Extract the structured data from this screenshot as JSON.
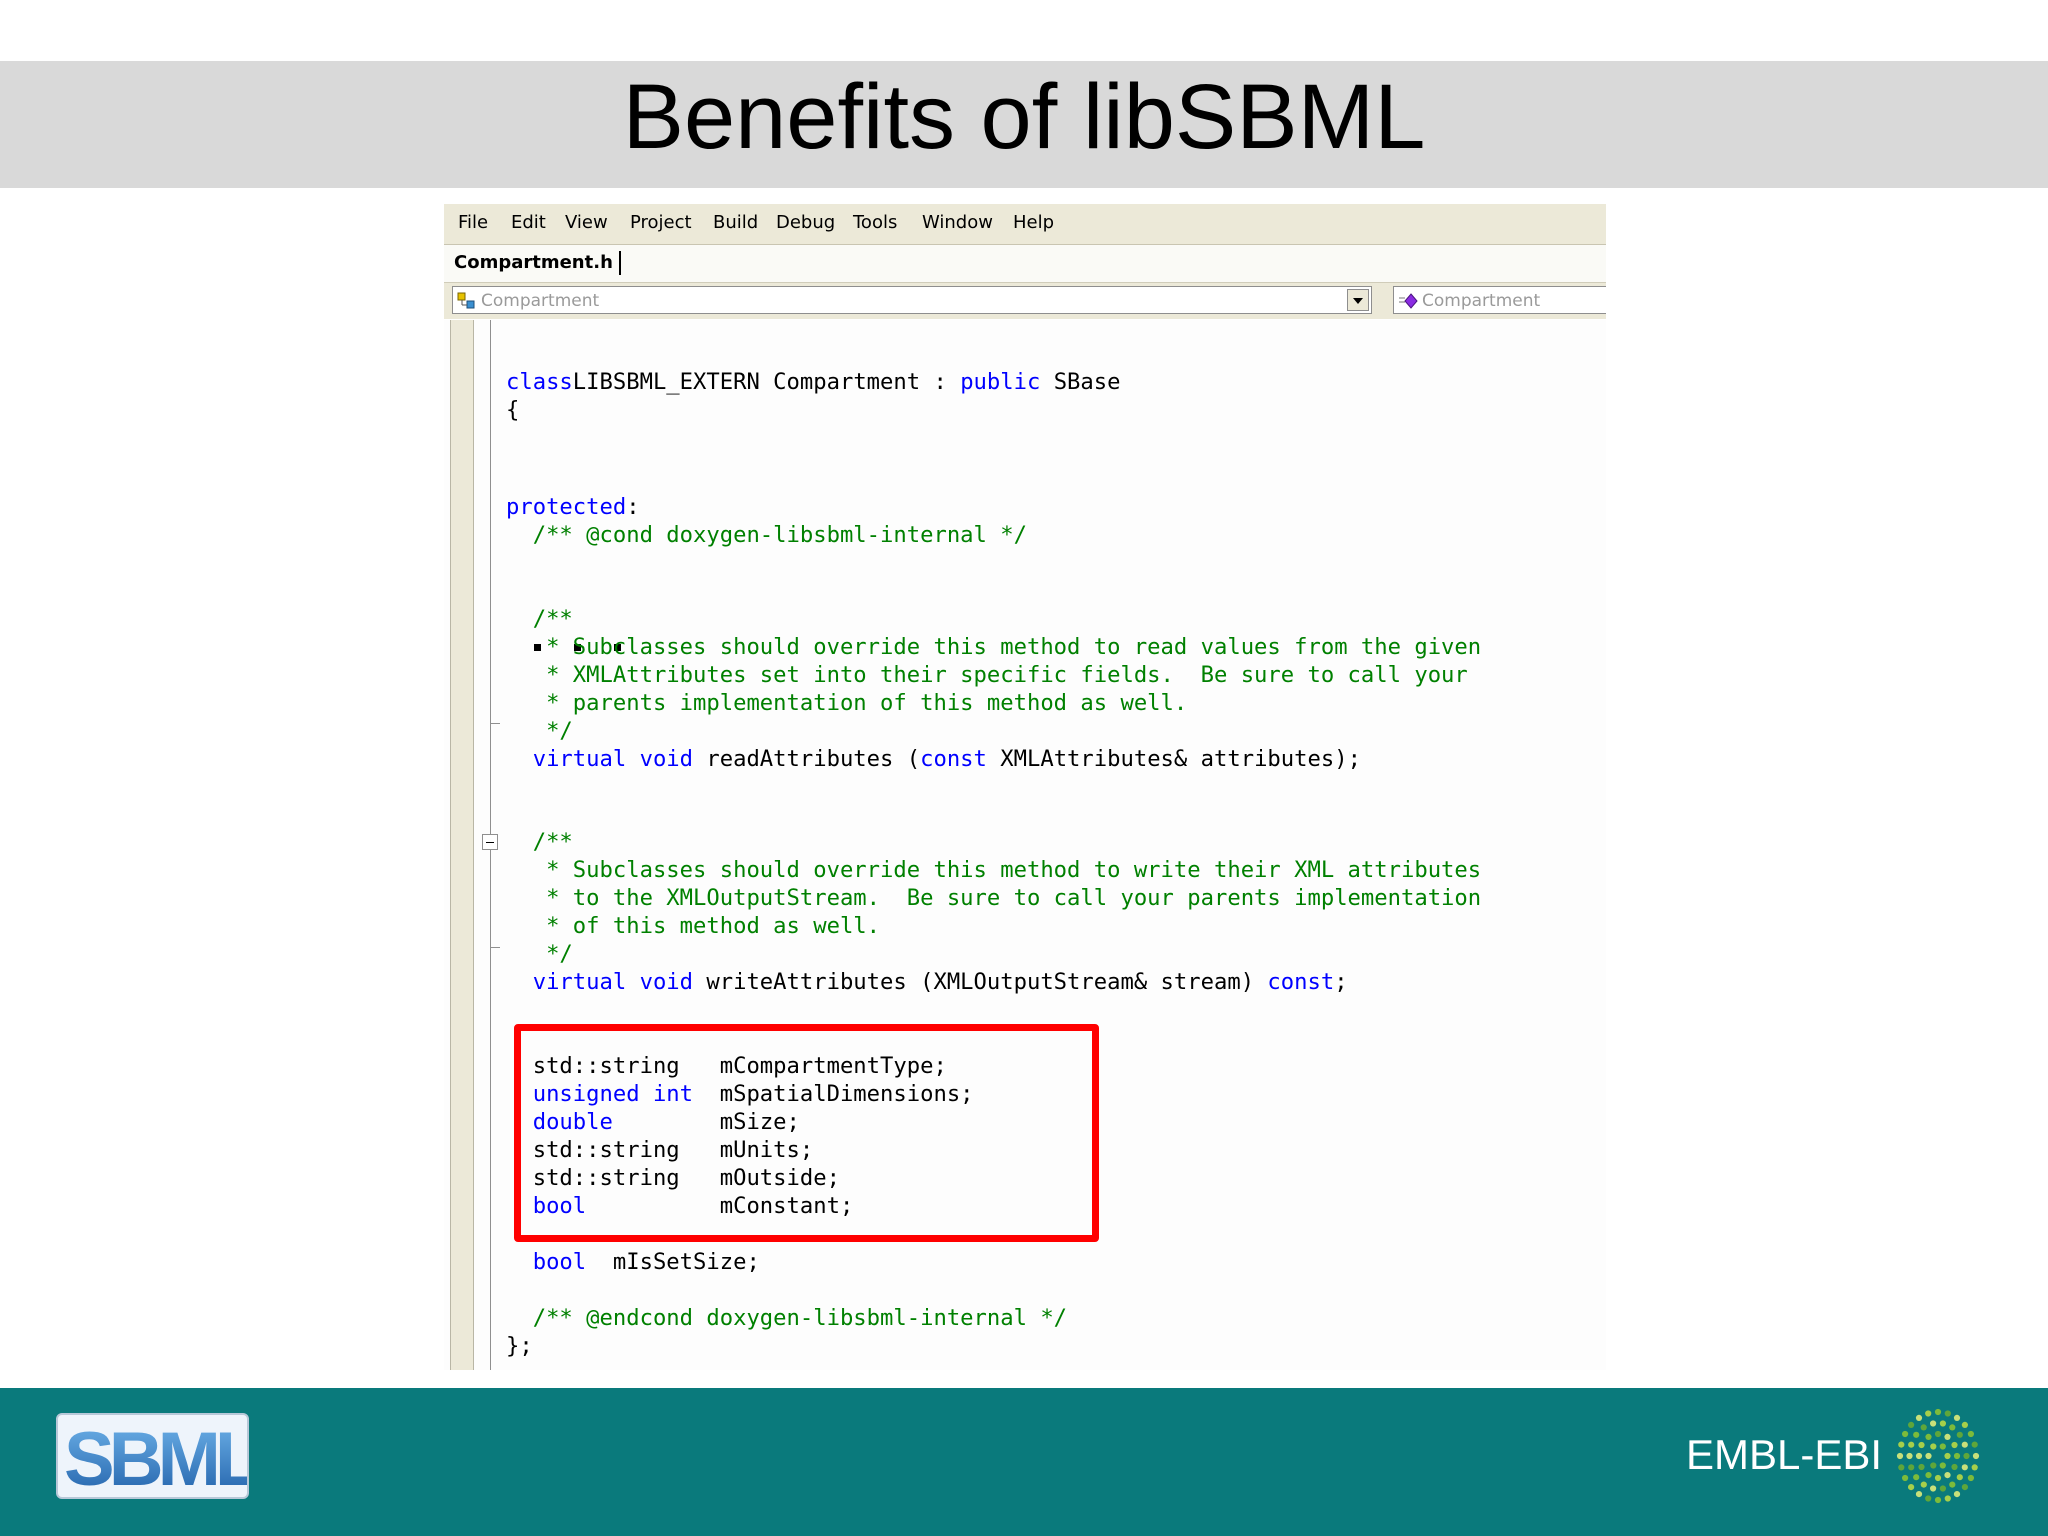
{
  "slide": {
    "title": "Benefits of libSBML"
  },
  "menubar": {
    "items": [
      "File",
      "Edit",
      "View",
      "Project",
      "Build",
      "Debug",
      "Tools",
      "Window",
      "Help"
    ]
  },
  "tab": {
    "label": "Compartment.h"
  },
  "combos": {
    "left_value": "Compartment",
    "right_value": "Compartment"
  },
  "code": {
    "lines": [
      {
        "parts": [
          [
            "kw",
            "class"
          ],
          [
            "",
            "LIBSBML_EXTERN Compartment : "
          ],
          [
            "kw",
            "public"
          ],
          [
            "",
            " SBase"
          ]
        ]
      },
      {
        "parts": [
          [
            "",
            "{"
          ]
        ]
      },
      {
        "parts": [
          [
            "kw",
            "protected"
          ],
          [
            "",
            ":"
          ]
        ]
      },
      {
        "parts": [
          [
            "cm",
            "  /** @cond doxygen-libsbml-internal */"
          ]
        ]
      },
      {
        "parts": [
          [
            "cm",
            "  /**"
          ]
        ]
      },
      {
        "parts": [
          [
            "cm",
            "   * Subclasses should override this method to read values from the given"
          ]
        ]
      },
      {
        "parts": [
          [
            "cm",
            "   * XMLAttributes set into their specific fields.  Be sure to call your"
          ]
        ]
      },
      {
        "parts": [
          [
            "cm",
            "   * parents implementation of this method as well."
          ]
        ]
      },
      {
        "parts": [
          [
            "cm",
            "   */"
          ]
        ]
      },
      {
        "parts": [
          [
            "kw",
            "  virtual void"
          ],
          [
            "",
            " readAttributes ("
          ],
          [
            "kw",
            "const"
          ],
          [
            "",
            " XMLAttributes& attributes);"
          ]
        ]
      },
      {
        "parts": [
          [
            "cm",
            "  /**"
          ]
        ]
      },
      {
        "parts": [
          [
            "cm",
            "   * Subclasses should override this method to write their XML attributes"
          ]
        ]
      },
      {
        "parts": [
          [
            "cm",
            "   * to the XMLOutputStream.  Be sure to call your parents implementation"
          ]
        ]
      },
      {
        "parts": [
          [
            "cm",
            "   * of this method as well."
          ]
        ]
      },
      {
        "parts": [
          [
            "cm",
            "   */"
          ]
        ]
      },
      {
        "parts": [
          [
            "kw",
            "  virtual void"
          ],
          [
            "",
            " writeAttributes (XMLOutputStream& stream) "
          ],
          [
            "kw",
            "const"
          ],
          [
            "",
            ";"
          ]
        ]
      },
      {
        "parts": [
          [
            "",
            "  std::string   mCompartmentType;"
          ]
        ]
      },
      {
        "parts": [
          [
            "kw",
            "  unsigned int"
          ],
          [
            "",
            "  mSpatialDimensions;"
          ]
        ]
      },
      {
        "parts": [
          [
            "kw",
            "  double"
          ],
          [
            "",
            "        mSize;"
          ]
        ]
      },
      {
        "parts": [
          [
            "",
            "  std::string   mUnits;"
          ]
        ]
      },
      {
        "parts": [
          [
            "",
            "  std::string   mOutside;"
          ]
        ]
      },
      {
        "parts": [
          [
            "kw",
            "  bool"
          ],
          [
            "",
            "          mConstant;"
          ]
        ]
      },
      {
        "parts": [
          [
            "kw",
            "  bool"
          ],
          [
            "",
            "  mIsSetSize;"
          ]
        ]
      },
      {
        "parts": [
          [
            "cm",
            "  /** @endcond doxygen-libsbml-internal */"
          ]
        ]
      },
      {
        "parts": [
          [
            "",
            "};"
          ]
        ]
      }
    ]
  },
  "footer": {
    "embl_label": "EMBL-EBI",
    "sbml_logo_text": "SBML"
  },
  "colors": {
    "keyword": "#0000ff",
    "comment": "#008000",
    "highlight_box": "#ff0000",
    "footer": "#0a7a7c",
    "title_band": "#d9d9d9"
  }
}
